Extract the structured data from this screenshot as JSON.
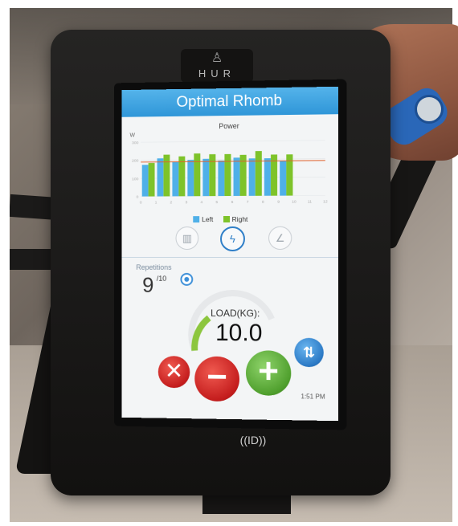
{
  "device": {
    "brand": "HUR",
    "nfc_label": "((ID))"
  },
  "screen": {
    "title": "Optimal Rhomb",
    "chart_title": "Power",
    "unit": "W",
    "legend": {
      "left": "Left",
      "right": "Right"
    },
    "repetitions": {
      "label": "Repetitions",
      "value": "9",
      "total": "/10"
    },
    "load": {
      "label": "LOAD(KG):",
      "value": "10.0"
    },
    "clock": "1:51 PM"
  },
  "colors": {
    "title_bar": "#3aa6e4",
    "left_series": "#4fb0e8",
    "right_series": "#7ec32a",
    "target_line": "#e0622c"
  },
  "icons": {
    "mode_1": "seat-icon",
    "mode_2": "lightning-icon",
    "mode_3": "angle-icon",
    "cancel": "close-icon",
    "minus": "minus-icon",
    "plus": "plus-icon",
    "user": "user-swap-icon"
  },
  "chart_data": {
    "type": "bar",
    "categories": [
      "1",
      "2",
      "3",
      "4",
      "5",
      "6",
      "7",
      "8",
      "9",
      "10",
      "11",
      "12"
    ],
    "series": [
      {
        "name": "Left",
        "values": [
          175,
          210,
          190,
          200,
          205,
          195,
          210,
          205,
          205,
          190,
          0,
          0
        ]
      },
      {
        "name": "Right",
        "values": [
          185,
          230,
          220,
          235,
          230,
          230,
          225,
          245,
          225,
          225,
          0,
          0
        ]
      }
    ],
    "y_ticks": [
      "0",
      "100",
      "200",
      "300"
    ],
    "x_ticks": [
      "0",
      "1",
      "2",
      "3",
      "4",
      "5",
      "6",
      "7",
      "8",
      "9",
      "10",
      "11",
      "12"
    ],
    "target_line": 190,
    "ylim": [
      0,
      300
    ],
    "title": "Power",
    "ylabel": "W"
  }
}
